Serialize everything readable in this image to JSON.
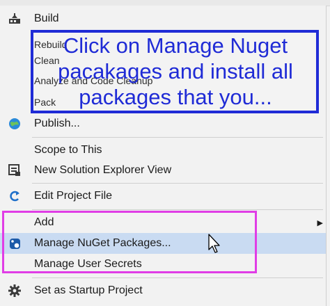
{
  "menu": {
    "items": [
      {
        "label": "Build",
        "icon": "build-icon"
      },
      {
        "label": "Rebuild"
      },
      {
        "label": "Clean"
      },
      {
        "label": "Analyze and Code Cleanup"
      },
      {
        "label": "Pack"
      },
      {
        "label": "Publish...",
        "icon": "globe-icon"
      },
      {
        "label": "Scope to This"
      },
      {
        "label": "New Solution Explorer View",
        "icon": "solution-explorer-icon"
      },
      {
        "label": "Edit Project File",
        "icon": "edit-refresh-icon"
      },
      {
        "label": "Add",
        "submenu": true
      },
      {
        "label": "Manage NuGet Packages...",
        "icon": "nuget-icon",
        "highlighted": true
      },
      {
        "label": "Manage User Secrets"
      },
      {
        "label": "Set as Startup Project",
        "icon": "gear-icon"
      }
    ]
  },
  "annotation": {
    "text": "Click on Manage Nuget pacakages and install all packages that you...",
    "color": "#1f2bd6",
    "highlight_color": "#e03de6"
  }
}
